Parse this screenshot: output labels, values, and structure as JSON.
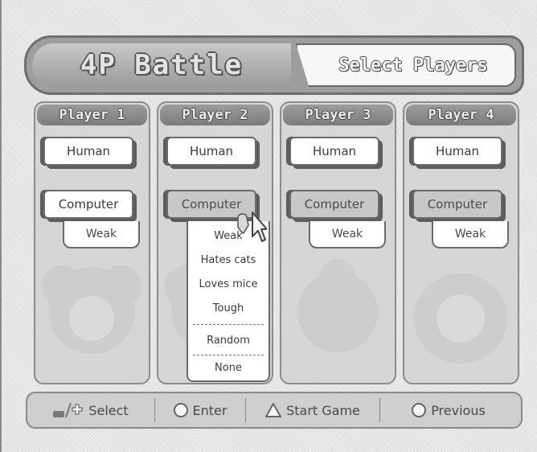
{
  "header": {
    "title": "4P Battle",
    "subtitle": "Select Players"
  },
  "players": [
    {
      "name": "Player 1",
      "human": "Human",
      "computer": "Computer",
      "level": "Weak"
    },
    {
      "name": "Player 2",
      "human": "Human",
      "computer": "Computer",
      "level": "Weak"
    },
    {
      "name": "Player 3",
      "human": "Human",
      "computer": "Computer",
      "level": "Weak"
    },
    {
      "name": "Player 4",
      "human": "Human",
      "computer": "Computer",
      "level": "Weak"
    }
  ],
  "dropdown": {
    "items": [
      "Weak",
      "Hates cats",
      "Loves mice",
      "Tough",
      "Random",
      "None"
    ]
  },
  "footer": {
    "select": "Select",
    "enter": "Enter",
    "start": "Start Game",
    "previous": "Previous"
  },
  "icons": {
    "dpad": "dpad-icon",
    "enter": "circle-button-icon",
    "start": "triangle-button-icon",
    "previous": "circle-button-icon"
  }
}
